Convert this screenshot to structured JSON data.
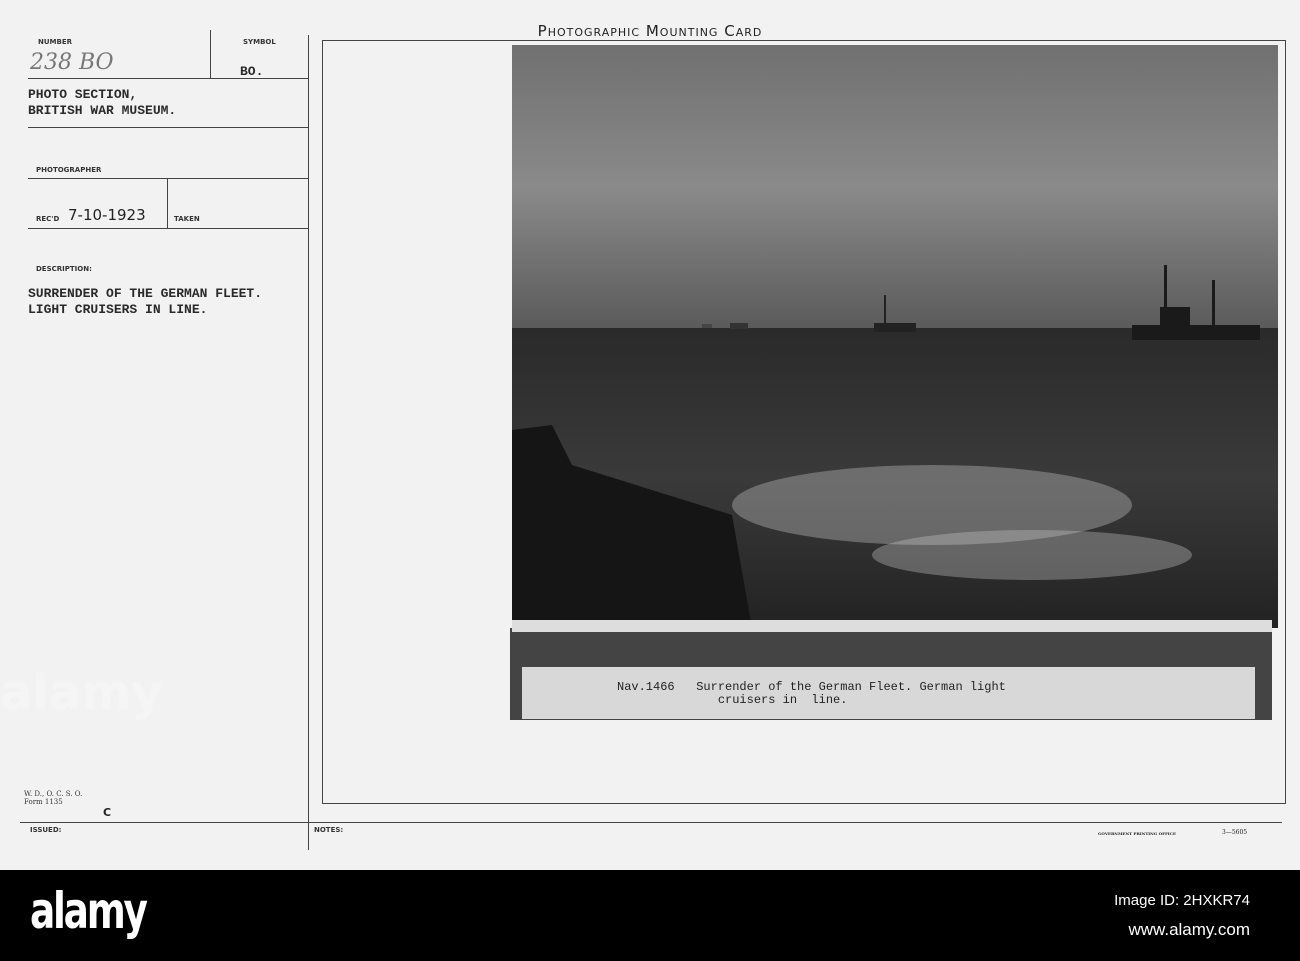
{
  "card": {
    "title": "Photographic Mounting Card",
    "number_label": "NUMBER",
    "number": "238 BO",
    "symbol_label": "SYMBOL",
    "symbol": "BO.",
    "source": "PHOTO SECTION,\nBRITISH WAR MUSEUM.",
    "photographer_label": "PHOTOGRAPHER",
    "recd_label": "REC'D",
    "recd": "7-10-1923",
    "taken_label": "TAKEN",
    "description_label": "DESCRIPTION:",
    "description": "SURRENDER OF THE GERMAN FLEET.\nLIGHT CRUISERS IN LINE.",
    "form": "W. D., O. C. S. O.\nForm 1135",
    "form_letter": "C",
    "issued_label": "ISSUED:",
    "notes_label": "NOTES:",
    "printer": "GOVERNMENT PRINTING OFFICE",
    "printer_code": "3—5605"
  },
  "photo": {
    "caption": "Nav.1466   Surrender of the German Fleet. German light\n              cruisers in  line."
  },
  "watermark": "alamy",
  "footer": {
    "logo": "alamy",
    "image_id": "Image ID: 2HXKR74",
    "url": "www.alamy.com"
  }
}
